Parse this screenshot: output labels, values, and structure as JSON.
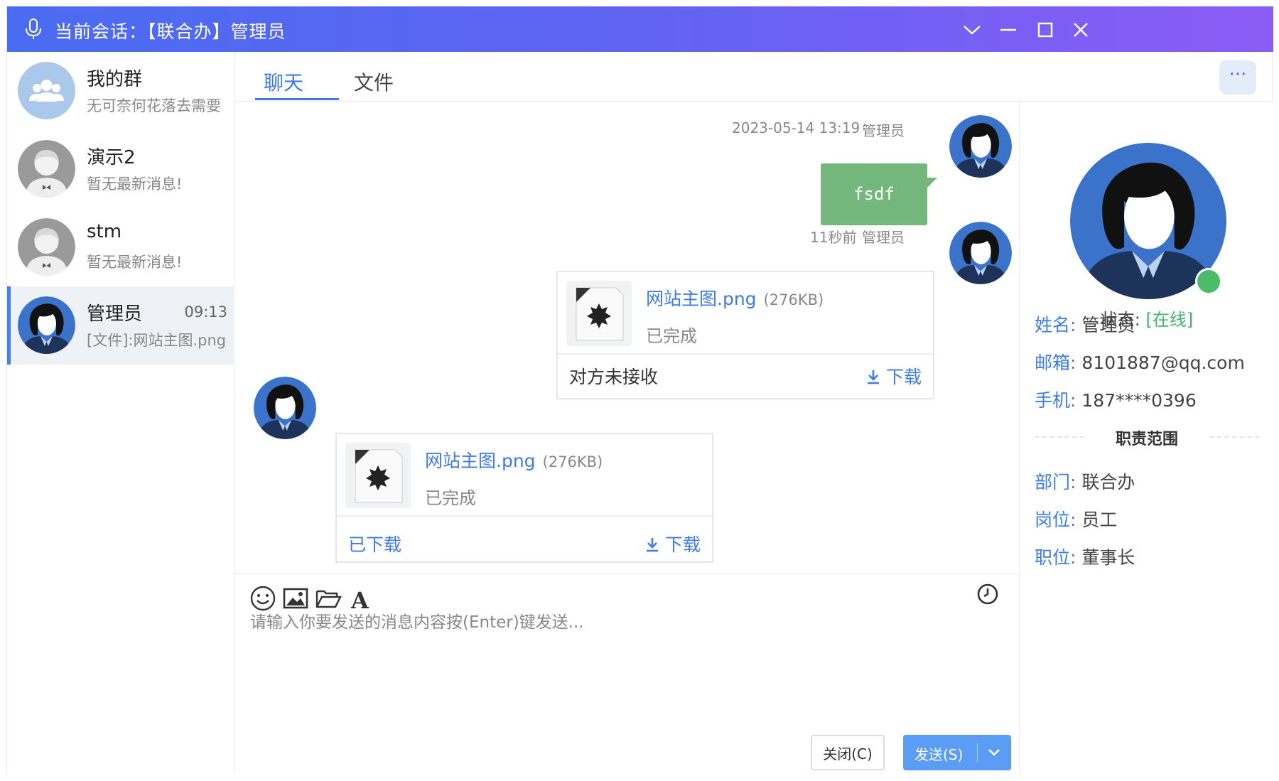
{
  "window": {
    "title": "当前会话：【联合办】管理员"
  },
  "conversations": [
    {
      "name": "我的群",
      "last_message": "无可奈何花落去需要",
      "time": "",
      "avatar": "group-icon"
    },
    {
      "name": "演示2",
      "last_message": "暂无最新消息!",
      "time": "",
      "avatar": "user-gray-avatar"
    },
    {
      "name": "stm",
      "last_message": "暂无最新消息!",
      "time": "",
      "avatar": "user-gray-avatar"
    },
    {
      "name": "管理员",
      "last_message": "[文件]:网站主图.png",
      "time": "09:13",
      "avatar": "user-admin-avatar",
      "active": true
    }
  ],
  "tabs": [
    {
      "label": "聊天",
      "active": true
    },
    {
      "label": "文件",
      "active": false
    }
  ],
  "more_label": "···",
  "messages": [
    {
      "type": "text",
      "time": "2023-05-14 13:19",
      "sender": "管理员",
      "content": "fsdf",
      "side": "right"
    },
    {
      "type": "file",
      "time": "11秒前",
      "sender": "管理员",
      "side": "right",
      "file_name": "网站主图.png",
      "file_size": "(276KB)",
      "status": "已完成",
      "footer_text": "对方未接收",
      "download_label": "下载"
    },
    {
      "type": "file",
      "side": "left",
      "file_name": "网站主图.png",
      "file_size": "(276KB)",
      "status": "已完成",
      "footer_text": "已下载",
      "download_label": "下载"
    }
  ],
  "input": {
    "placeholder": "请输入你要发送的消息内容按(Enter)键发送...",
    "close_label": "关闭(C)",
    "send_label": "发送(S)"
  },
  "profile": {
    "status_label": "状态:",
    "status_value": "[在线]",
    "fields": [
      {
        "label": "姓名:",
        "value": "管理员"
      },
      {
        "label": "邮箱:",
        "value": "8101887@qq.com"
      },
      {
        "label": "手机:",
        "value": "187****0396"
      }
    ],
    "section_title": "职责范围",
    "duties": [
      {
        "label": "部门:",
        "value": "联合办"
      },
      {
        "label": "岗位:",
        "value": "员工"
      },
      {
        "label": "职位:",
        "value": "董事长"
      }
    ]
  },
  "colors": {
    "accent": "#3f7be6",
    "bubble": "#74b77c",
    "online": "#4dbb6a",
    "send_button": "#5b9cf5"
  }
}
